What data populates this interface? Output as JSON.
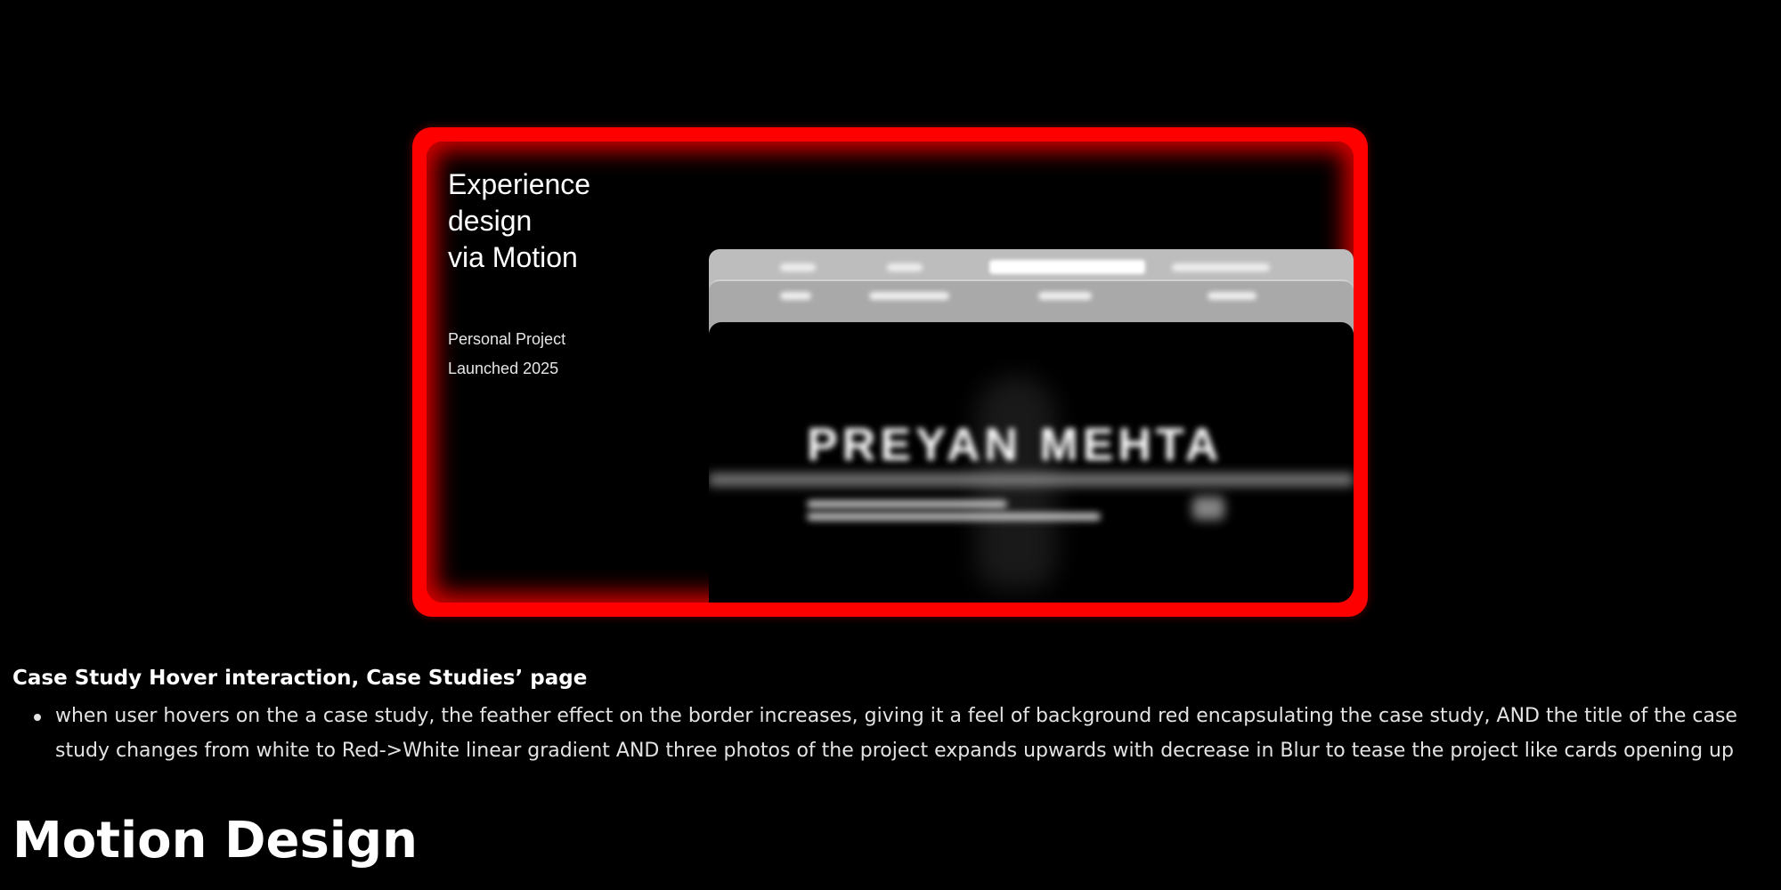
{
  "case_study_card": {
    "title": "Experience\ndesign\nvia Motion",
    "meta_type": "Personal Project",
    "meta_launch": "Launched 2025",
    "preview_name": "PREYAN MEHTA",
    "accent_color": "#ff0000"
  },
  "description": {
    "heading": "Case Study Hover interaction, Case Studies’ page",
    "bullets": [
      "when user hovers on the a case study, the feather effect on the border increases, giving it a feel of background red encapsulating the case study, AND the title of the case study changes from white to Red->White linear gradient AND three photos of the project expands upwards with decrease in Blur to tease the project like cards opening up"
    ]
  },
  "section": {
    "title": "Motion Design"
  }
}
